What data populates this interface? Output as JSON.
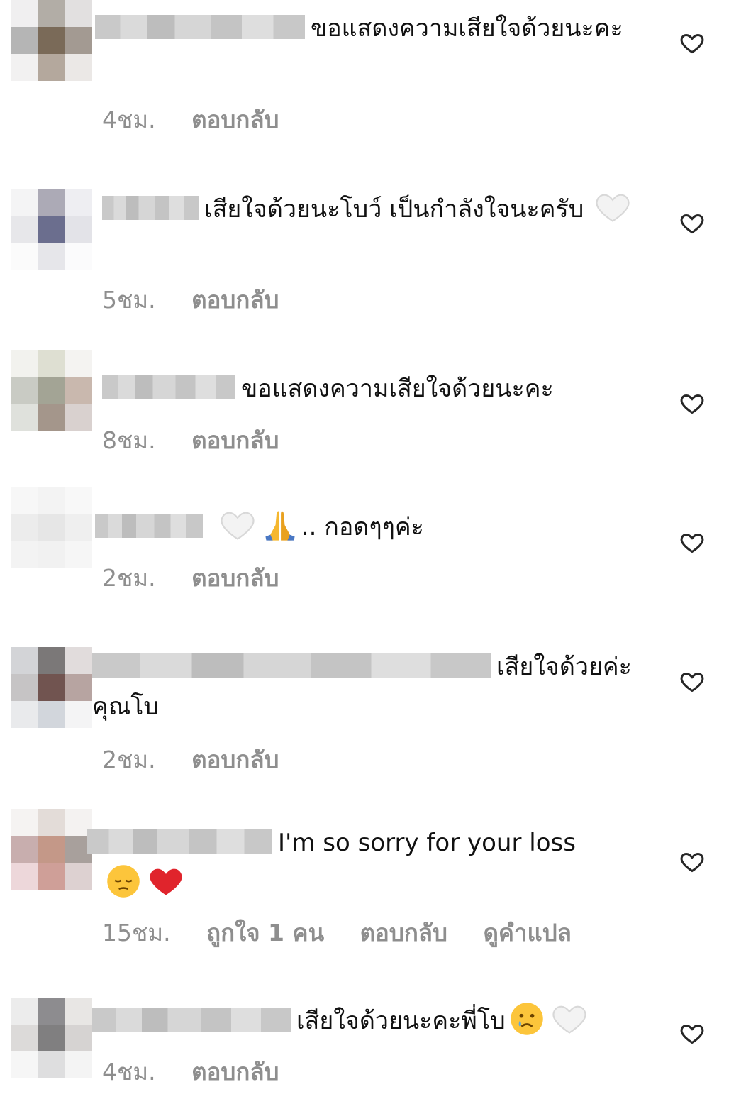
{
  "comments": [
    {
      "text": "ขอแสดงความเสียใจด้วยนะคะ",
      "time": "4ชม.",
      "reply": "ตอบกลับ"
    },
    {
      "text": "เสียใจด้วยนะโบว์ เป็นกำลังใจนะครับ",
      "time": "5ชม.",
      "reply": "ตอบกลับ",
      "emoji": "white-heart"
    },
    {
      "text": "ขอแสดงความเสียใจด้วยนะคะ",
      "time": "8ชม.",
      "reply": "ตอบกลับ"
    },
    {
      "text": ".. กอดๆๆค่ะ",
      "time": "2ชม.",
      "reply": "ตอบกลับ",
      "emoji": [
        "white-heart",
        "folded-hands"
      ]
    },
    {
      "text": "เสียใจด้วยค่ะคุณโบ",
      "time": "2ชม.",
      "reply": "ตอบกลับ"
    },
    {
      "text": "I'm so sorry for your loss",
      "time": "15ชม.",
      "likes": "ถูกใจ 1 คน",
      "reply": "ตอบกลับ",
      "translate": "ดูคำแปล",
      "emoji": [
        "pensive-face",
        "red-heart"
      ]
    },
    {
      "text": "เสียใจด้วยนะคะพี่โบ",
      "time": "4ชม.",
      "reply": "ตอบกลับ",
      "emoji": [
        "crying-face",
        "white-heart"
      ]
    }
  ],
  "icons": {
    "like": "heart-outline-icon"
  },
  "colors": {
    "meta": "#8e8e8e",
    "text": "#111111",
    "heart_stroke": "#262626",
    "red_heart": "#e0242c"
  }
}
